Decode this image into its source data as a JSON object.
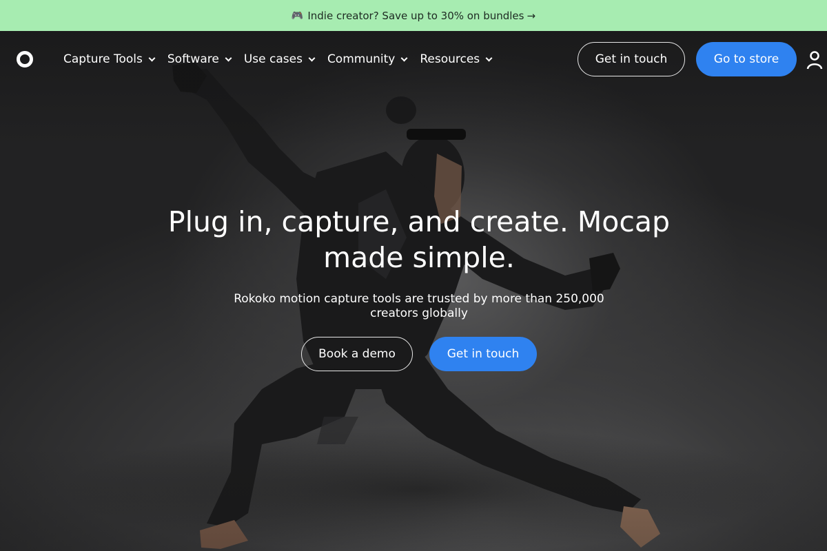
{
  "promo": {
    "icon": "gamepad-icon",
    "text": "Indie creator? Save up to 30% on bundles",
    "arrow": "→"
  },
  "nav": {
    "logo_icon": "ring-logo-icon",
    "items": [
      {
        "label": "Capture Tools"
      },
      {
        "label": "Software"
      },
      {
        "label": "Use cases"
      },
      {
        "label": "Community"
      },
      {
        "label": "Resources"
      }
    ],
    "get_in_touch": "Get in touch",
    "go_to_store": "Go to store",
    "account_icon": "user-icon"
  },
  "hero": {
    "headline_line1": "Plug in, capture, and create. Mocap",
    "headline_line2": "made simple.",
    "sub_line1": "Rokoko motion capture tools are trusted by more than 250,000",
    "sub_line2": "creators globally",
    "book_demo": "Book a demo",
    "get_in_touch": "Get in touch"
  },
  "colors": {
    "promo_bg": "#a7ecb1",
    "accent_blue": "#2f82f0",
    "background": "#2b2b2c"
  }
}
